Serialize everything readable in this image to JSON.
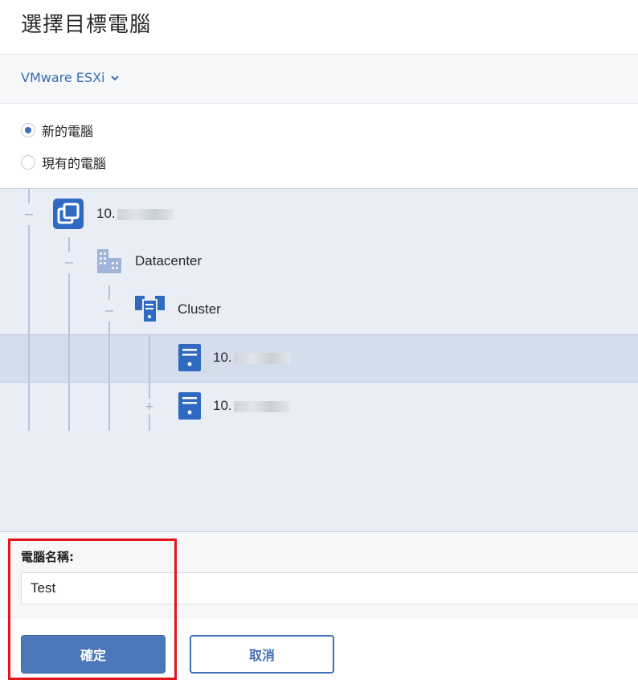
{
  "dialog": {
    "title": "選擇目標電腦"
  },
  "platform": {
    "label": "VMware ESXi"
  },
  "options": {
    "new_machine": "新的電腦",
    "existing_machine": "現有的電腦",
    "selected": "new_machine"
  },
  "tree": {
    "root": {
      "label": "10.",
      "icon": "vcenter-icon"
    },
    "datacenter": {
      "label": "Datacenter",
      "icon": "building-icon"
    },
    "cluster": {
      "label": "Cluster",
      "icon": "cluster-icon"
    },
    "host1": {
      "label": "10.",
      "icon": "server-icon",
      "selected": true
    },
    "host2": {
      "label": "10.",
      "icon": "server-icon"
    }
  },
  "form": {
    "name_label": "電腦名稱:",
    "name_value": "Test"
  },
  "buttons": {
    "ok": "確定",
    "cancel": "取消"
  },
  "colors": {
    "accent": "#3f6fb6",
    "highlight": "#e3141b",
    "tree_bg": "#e9edf5",
    "selected_row": "#d3ddec"
  }
}
